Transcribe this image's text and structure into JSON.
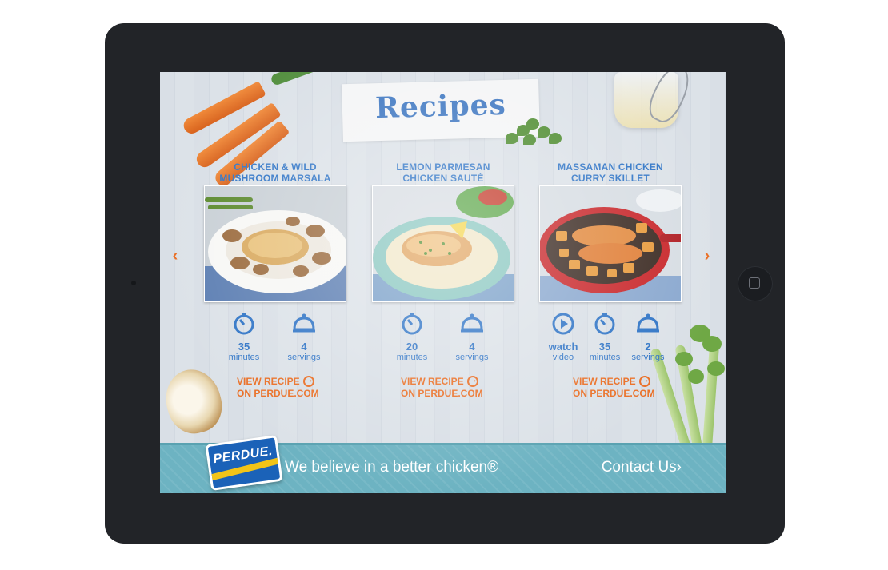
{
  "page_title": "Recipes",
  "accent_colors": {
    "blue": "#2f74c6",
    "orange": "#ea6e24",
    "footer": "#6db3c2"
  },
  "recipes": [
    {
      "title_line1": "CHICKEN & WILD",
      "title_line2": "MUSHROOM MARSALA",
      "time_value": "35",
      "time_unit": "minutes",
      "servings_value": "4",
      "servings_unit": "servings",
      "link_line1": "VIEW RECIPE",
      "link_line2": "ON PERDUE.COM"
    },
    {
      "title_line1": "LEMON PARMESAN",
      "title_line2": "CHICKEN SAUTÉ",
      "time_value": "20",
      "time_unit": "minutes",
      "servings_value": "4",
      "servings_unit": "servings",
      "link_line1": "VIEW RECIPE",
      "link_line2": "ON PERDUE.COM"
    },
    {
      "title_line1": "MASSAMAN CHICKEN",
      "title_line2": "CURRY SKILLET",
      "video_value": "watch",
      "video_unit": "video",
      "time_value": "35",
      "time_unit": "minutes",
      "servings_value": "2",
      "servings_unit": "servings",
      "link_line1": "VIEW RECIPE",
      "link_line2": "ON PERDUE.COM"
    }
  ],
  "footer": {
    "logo_text": "PERDUE.",
    "tagline": "We believe in a better chicken®",
    "contact": "Contact Us›"
  },
  "nav": {
    "prev": "‹",
    "next": "›"
  }
}
